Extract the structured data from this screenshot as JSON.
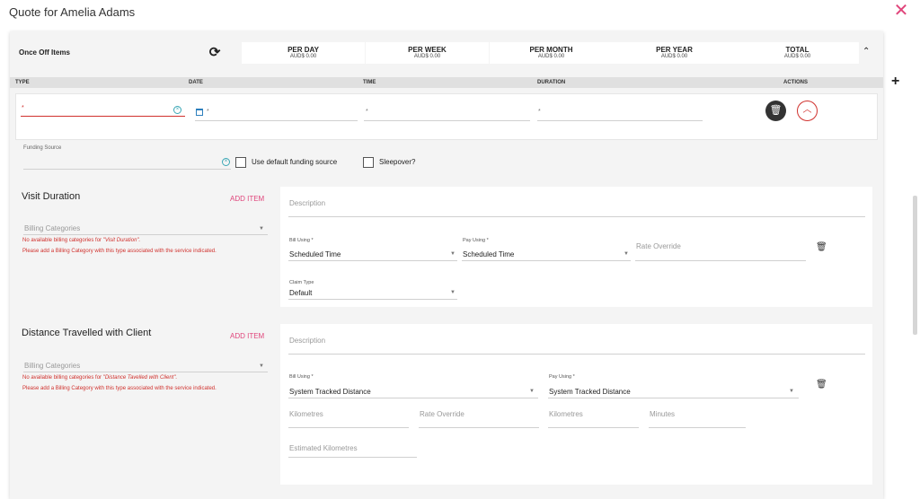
{
  "window": {
    "title": "Quote for Amelia Adams",
    "close_icon": "close-icon",
    "add_icon": "plus-icon"
  },
  "header": {
    "label": "Once Off Items",
    "summaries": [
      {
        "label": "PER DAY",
        "value": "AUD$ 0.00"
      },
      {
        "label": "PER WEEK",
        "value": "AUD$ 0.00"
      },
      {
        "label": "PER MONTH",
        "value": "AUD$ 0.00"
      },
      {
        "label": "PER YEAR",
        "value": "AUD$ 0.00"
      },
      {
        "label": "TOTAL",
        "value": "AUD$ 0.00"
      }
    ]
  },
  "columns": {
    "type": "TYPE",
    "date": "DATE",
    "time": "TIME",
    "duration": "DURATION",
    "actions": "ACTIONS"
  },
  "row": {
    "required_marker": "*"
  },
  "funding": {
    "label": "Funding Source",
    "use_default": "Use default funding source",
    "sleepover": "Sleepover?"
  },
  "sections": [
    {
      "title": "Visit Duration",
      "add_item": "ADD ITEM",
      "billing_placeholder": "Billing Categories",
      "error_prefix": "No available billing categories for ",
      "error_name": "\"Visit Duration\".",
      "error_line2": "Please add a Billing Category with this type associated with the service indicated.",
      "description": "Description",
      "bill_using_label": "Bill Using *",
      "bill_using_value": "Scheduled Time",
      "pay_using_label": "Pay Using *",
      "pay_using_value": "Scheduled Time",
      "rate_override": "Rate Override",
      "claim_type_label": "Claim Type",
      "claim_type_value": "Default"
    },
    {
      "title": "Distance Travelled with Client",
      "add_item": "ADD ITEM",
      "billing_placeholder": "Billing Categories",
      "error_prefix": "No available billing categories for ",
      "error_name": "\"Distance Tavelled with Client\".",
      "error_line2": "Please add a Billing Category with this type associated with the service indicated.",
      "description": "Description",
      "bill_using_label": "Bill Using *",
      "bill_using_value": "System Tracked Distance",
      "pay_using_label": "Pay Using *",
      "pay_using_value": "System Tracked Distance",
      "kilometres_1": "Kilometres",
      "rate_override": "Rate Override",
      "kilometres_2": "Kilometres",
      "minutes": "Minutes",
      "estimated_kilometres": "Estimated Kilometres"
    }
  ],
  "colors": {
    "accent": "#e0457b",
    "error": "#d0312d",
    "panel": "#f4f4f4"
  }
}
